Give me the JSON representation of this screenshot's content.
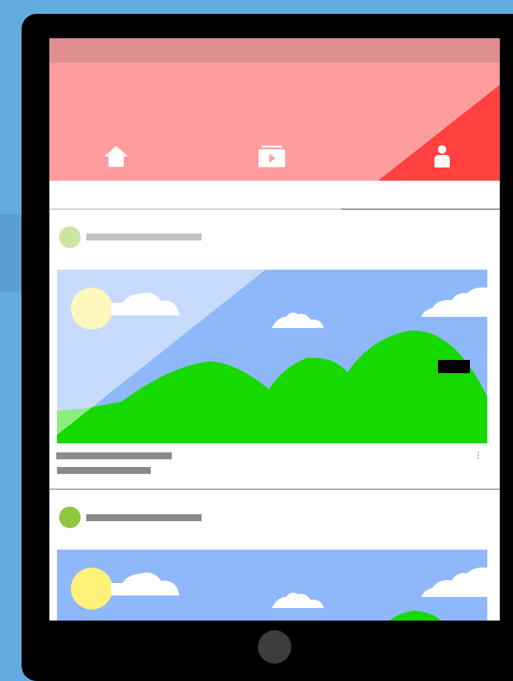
{
  "colors": {
    "background": "#63abdc",
    "tablet_frame": "#000000",
    "status_bar": "#df8f91",
    "app_bar": "#ff9d9e",
    "active_tab_highlight": "#ff4140",
    "tab_icon": "#ffffff",
    "sky": "#8fb8fa",
    "sun": "#fff17a",
    "hills": "#16d900",
    "cloud": "#ffffff",
    "placeholder_text_dark": "#8a8a8a",
    "placeholder_text_light": "#c2c2c2",
    "home_button": "#3d3d3d"
  },
  "tabs": [
    {
      "id": "home",
      "icon": "home-icon",
      "active": false
    },
    {
      "id": "subscriptions",
      "icon": "subscriptions-icon",
      "active": false
    },
    {
      "id": "account",
      "icon": "person-icon",
      "active": true
    }
  ],
  "feed": {
    "cards": [
      {
        "avatar_color": "#cbe6a3",
        "thumbnail": "landscape-image",
        "has_duration_badge": true,
        "has_overflow_menu": true,
        "pressed": true
      },
      {
        "avatar_color": "#8fc741",
        "thumbnail": "landscape-image",
        "has_duration_badge": false,
        "has_overflow_menu": false,
        "pressed": false
      }
    ]
  }
}
